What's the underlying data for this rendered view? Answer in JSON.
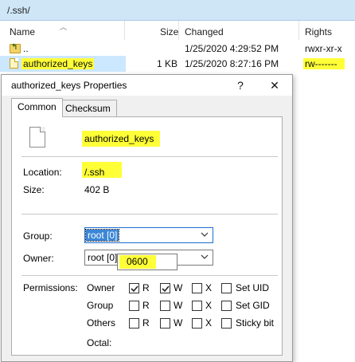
{
  "explorer": {
    "path": "/.ssh/",
    "columns": {
      "name": "Name",
      "size": "Size",
      "changed": "Changed",
      "rights": "Rights"
    },
    "rows": [
      {
        "name": "..",
        "size": "",
        "changed": "1/25/2020 4:29:52 PM",
        "rights": "rwxr-xr-x"
      },
      {
        "name": "authorized_keys",
        "size": "1 KB",
        "changed": "1/25/2020 8:27:16 PM",
        "rights": "rw-------"
      }
    ]
  },
  "dialog": {
    "title": "authorized_keys Properties",
    "help_label": "?",
    "close_label": "✕",
    "tabs": [
      {
        "label": "Common"
      },
      {
        "label": "Checksum"
      }
    ],
    "file_name": "authorized_keys",
    "location_label": "Location:",
    "location_value": "/.ssh",
    "size_label": "Size:",
    "size_value": "402 B",
    "group_label": "Group:",
    "group_value": "root [0]",
    "owner_label": "Owner:",
    "owner_value": "root [0]",
    "permissions_label": "Permissions:",
    "perm_rows": [
      {
        "who": "Owner",
        "r": true,
        "w": true,
        "x": false,
        "special": "Set UID",
        "special_checked": false
      },
      {
        "who": "Group",
        "r": false,
        "w": false,
        "x": false,
        "special": "Set GID",
        "special_checked": false
      },
      {
        "who": "Others",
        "r": false,
        "w": false,
        "x": false,
        "special": "Sticky bit",
        "special_checked": false
      }
    ],
    "perm_letters": {
      "r": "R",
      "w": "W",
      "x": "X"
    },
    "octal_label": "Octal:",
    "octal_value": "0600"
  },
  "colors": {
    "highlight": "#ffff38",
    "selection": "#cce8ff",
    "pathbar": "#cfe6f7",
    "focus": "#3a86d6"
  }
}
